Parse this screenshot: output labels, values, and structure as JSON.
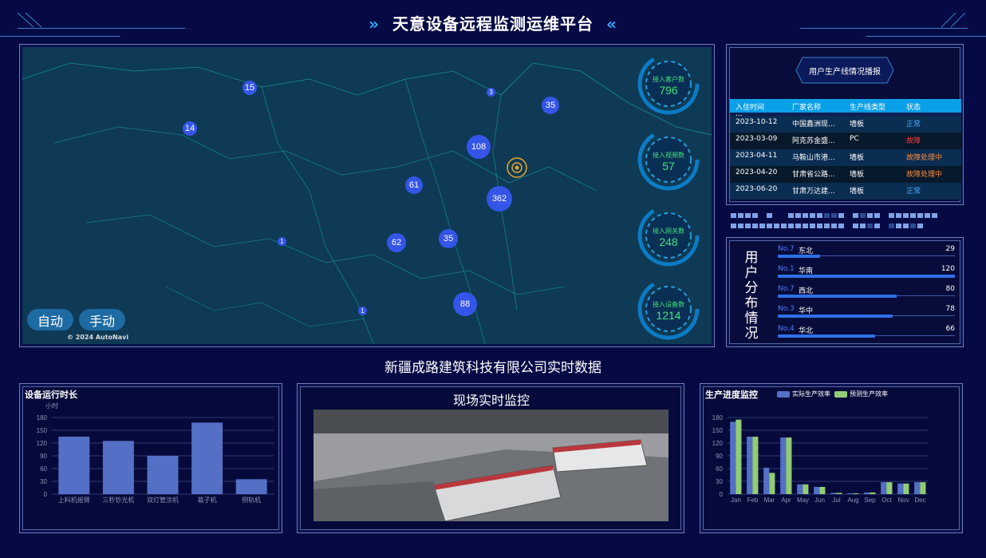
{
  "header": {
    "title": "天意设备远程监测运维平台",
    "left_chevron": "»",
    "right_chevron": "«"
  },
  "map": {
    "clusters": [
      {
        "label": "15"
      },
      {
        "label": "3"
      },
      {
        "label": "35"
      },
      {
        "label": "14"
      },
      {
        "label": "108"
      },
      {
        "label": "61"
      },
      {
        "label": "362"
      },
      {
        "label": "1"
      },
      {
        "label": "62"
      },
      {
        "label": "35"
      },
      {
        "label": "88"
      },
      {
        "label": "1"
      }
    ],
    "auto_btn": "自动",
    "manual_btn": "手动",
    "copyright": "© 2024 AutoNavi",
    "gauges": [
      {
        "label": "接入客户数",
        "value": "796"
      },
      {
        "label": "接入视频数",
        "value": "57"
      },
      {
        "label": "接入网关数",
        "value": "248"
      },
      {
        "label": "接入设备数",
        "value": "1214"
      }
    ]
  },
  "production_report": {
    "title": "用户生产线情况播报",
    "columns": [
      "入住时间",
      "厂家名称",
      "生产线类型",
      "状态"
    ],
    "rows": [
      {
        "date": "2023-10-12",
        "vendor": "中国鑫洲现...",
        "type": "墙板",
        "status": "正常",
        "status_color": "#3fb2ff"
      },
      {
        "date": "2023-03-09",
        "vendor": "阿克苏金盛...",
        "type": "PC",
        "status": "故障",
        "status_color": "#ff3b3b"
      },
      {
        "date": "2023-04-11",
        "vendor": "马鞍山市港...",
        "type": "墙板",
        "status": "故障处理中",
        "status_color": "#ff8a3b"
      },
      {
        "date": "2023-04-20",
        "vendor": "甘肃省公路...",
        "type": "墙板",
        "status": "故障处理中",
        "status_color": "#ff8a3b"
      },
      {
        "date": "2023-06-20",
        "vendor": "甘肃万达建...",
        "type": "墙板",
        "status": "正常",
        "status_color": "#3fb2ff"
      }
    ]
  },
  "distribution": {
    "title": "用户分布情况",
    "items": [
      {
        "rank": "No.7",
        "name": "东北",
        "value": "29",
        "ratio": 0.24
      },
      {
        "rank": "No.1",
        "name": "华南",
        "value": "120",
        "ratio": 1.0
      },
      {
        "rank": "No.7",
        "name": "西北",
        "value": "80",
        "ratio": 0.67
      },
      {
        "rank": "No.3",
        "name": "华中",
        "value": "78",
        "ratio": 0.65
      },
      {
        "rank": "No.4",
        "name": "华北",
        "value": "66",
        "ratio": 0.55
      }
    ]
  },
  "company_title": "新疆成路建筑科技有限公司实时数据",
  "runtime_chart_title": "设备运行时长",
  "monitor_title": "现场实时监控",
  "progress_chart_title": "生产进度监控",
  "chart_data": [
    {
      "type": "bar",
      "title": "设备运行时长",
      "ylabel": "小时",
      "categories": [
        "上料机摇臂",
        "三秒钞光机",
        "双灯管涂机",
        "裁子机",
        "侧轨机"
      ],
      "values": [
        135,
        125,
        90,
        168,
        35
      ],
      "ylim": [
        0,
        180
      ],
      "yticks": [
        0,
        30,
        60,
        90,
        120,
        150,
        180
      ],
      "color": "#5470c6"
    },
    {
      "type": "bar",
      "title": "生产进度监控",
      "categories": [
        "Jan",
        "Feb",
        "Mar",
        "Apr",
        "May",
        "Jun",
        "Jul",
        "Aug",
        "Sep",
        "Oct",
        "Nov",
        "Dec"
      ],
      "series": [
        {
          "name": "实际生产效率",
          "values": [
            170,
            135,
            62,
            133,
            23,
            17,
            3,
            2,
            4,
            28,
            25,
            28
          ],
          "color": "#5470c6"
        },
        {
          "name": "预测生产效率",
          "values": [
            175,
            135,
            50,
            133,
            23,
            17,
            3,
            2,
            4,
            28,
            25,
            28
          ],
          "color": "#91cc75"
        }
      ],
      "ylim": [
        0,
        180
      ],
      "yticks": [
        0,
        30,
        60,
        90,
        120,
        150,
        180
      ]
    }
  ]
}
